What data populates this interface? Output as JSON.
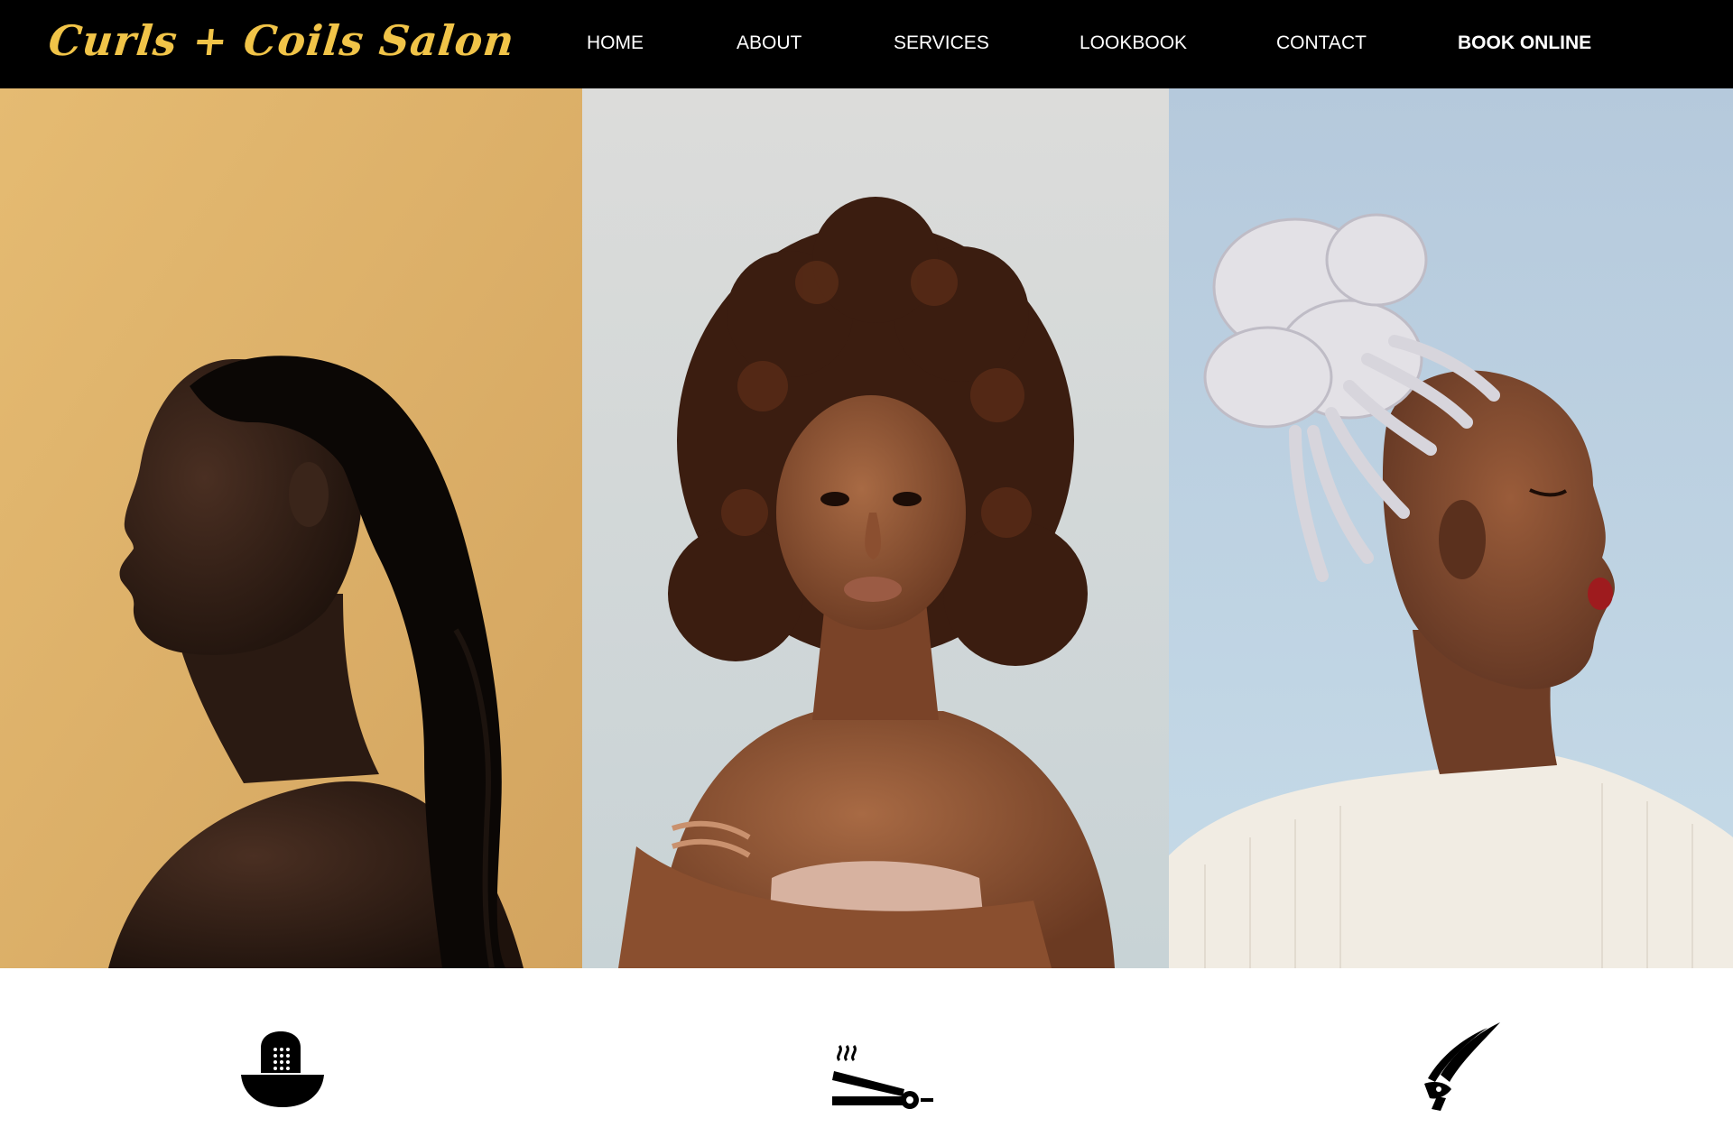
{
  "brand": {
    "name": "Curls + Coils Salon",
    "accent_color": "#f1c448"
  },
  "nav": {
    "items": [
      {
        "label": "HOME"
      },
      {
        "label": "ABOUT"
      },
      {
        "label": "SERVICES"
      },
      {
        "label": "LOOKBOOK"
      },
      {
        "label": "CONTACT"
      },
      {
        "label": "BOOK ONLINE"
      }
    ]
  },
  "hero": {
    "photos": [
      {
        "icon": "profile-photo-sleek-ponytail",
        "background": "#dcb16d"
      },
      {
        "icon": "portrait-photo-curly-hair",
        "background": "#d9dcdc"
      },
      {
        "icon": "profile-photo-braided-bun",
        "background": "#bccfdd"
      }
    ]
  },
  "services": {
    "icons": [
      {
        "icon": "shampoo-basin-icon"
      },
      {
        "icon": "flat-iron-icon"
      },
      {
        "icon": "hair-clip-icon"
      }
    ]
  }
}
